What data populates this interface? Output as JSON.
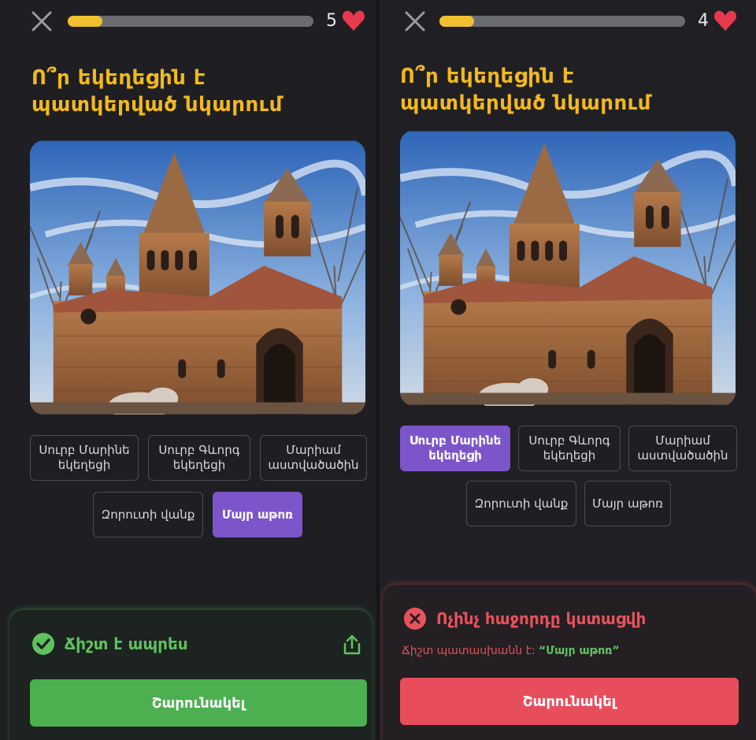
{
  "screens": [
    {
      "lives": "5",
      "progress": 0.14,
      "question": "Ո՞ր եկեղեցին է պատկերված նկարում",
      "options": [
        {
          "label": "Սուրբ Մարինե եկեղեցի",
          "selected": false
        },
        {
          "label": "Սուրբ Գևորգ եկեղեցի",
          "selected": false
        },
        {
          "label": "Մարիամ աստվածածին",
          "selected": false
        },
        {
          "label": "Զորուտի վանք",
          "selected": false
        },
        {
          "label": "Մայր աթոռ",
          "selected": true
        }
      ],
      "feedback": {
        "status": "correct",
        "title": "Ճիշտ է ապրես"
      },
      "continue_label": "Շարունակել"
    },
    {
      "lives": "4",
      "progress": 0.14,
      "question": "Ո՞ր եկեղեցին է պատկերված նկարում",
      "options": [
        {
          "label": "Սուրբ Մարինե եկեղեցի",
          "selected": true
        },
        {
          "label": "Սուրբ Գևորգ եկեղեցի",
          "selected": false
        },
        {
          "label": "Մարիամ աստվածածին",
          "selected": false
        },
        {
          "label": "Զորուտի վանք",
          "selected": false
        },
        {
          "label": "Մայր աթոռ",
          "selected": false
        }
      ],
      "feedback": {
        "status": "incorrect",
        "title": "Ոչինչ հաջորդը կստացվի",
        "answer_prefix": "Ճիշտ պատասխանն է:",
        "answer": "“Մայր աթոռ”"
      },
      "continue_label": "Շարունակել"
    }
  ],
  "colors": {
    "accent_yellow": "#f2b81e",
    "selected_purple": "#7b55c9",
    "success_green": "#4caf50",
    "error_red": "#e84d5b"
  },
  "icons": [
    "close-icon",
    "heart-icon",
    "check-icon",
    "share-icon",
    "x-circle-icon"
  ]
}
